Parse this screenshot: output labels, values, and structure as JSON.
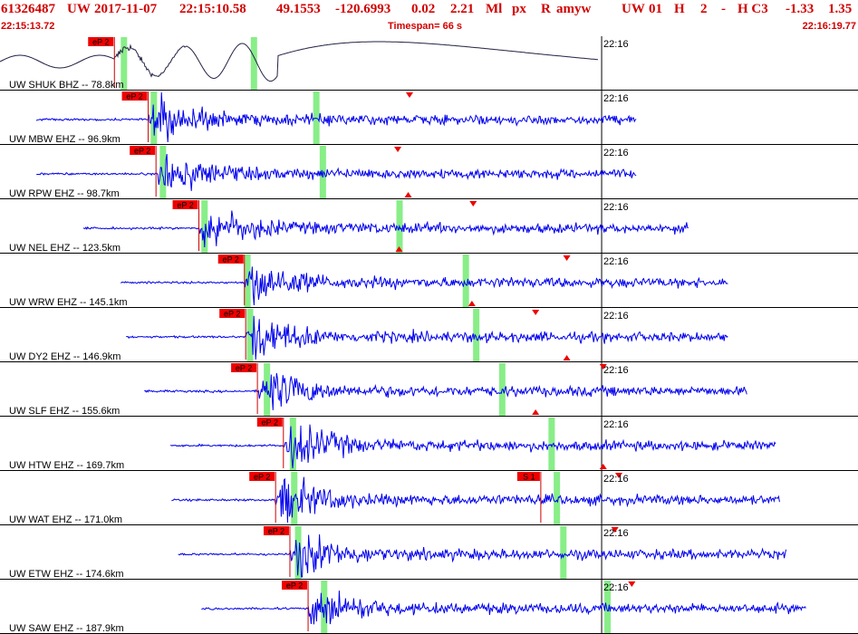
{
  "header": {
    "event_id": "61326487",
    "network": "UW",
    "origin_date": "2017-11-07",
    "origin_time": "22:15:10.58",
    "lat": "49.1553",
    "lon": "-120.6993",
    "depth": "0.02",
    "magnitude": "2.21",
    "mag_type": "Ml",
    "etype": "px",
    "review": "R",
    "author": "amyw",
    "net_code": "UW",
    "version": "01",
    "gtype": "H",
    "nph": "2",
    "flag": "-",
    "qual": "H C3",
    "v1": "-1.33",
    "v2": "1.35",
    "start_time": "22:15:13.72",
    "timespan_label": "Timespan=  66 s",
    "end_time": "22:16:19.77"
  },
  "colors": {
    "trace": "#0000ee",
    "trace_first": "#222244",
    "pick_box": "#ee0000",
    "pick_line": "#cc0000",
    "window_bar": "#88ee88",
    "header_text": "#d10000",
    "triangle": "#ee0000"
  },
  "chart_data": {
    "type": "seismogram",
    "x_range_s": [
      0,
      66
    ],
    "minute_marker_label": "22:16",
    "minute_marker_s": 46.28,
    "traces": [
      {
        "label": "UW SHUK BHZ -- 78.8km",
        "pick": "eP 2",
        "p_s": 8.8,
        "green_s": [
          9.5,
          19.5
        ],
        "trace_span_s": [
          0,
          46
        ],
        "style": "low-freq",
        "triangles": []
      },
      {
        "label": "UW MBW EHZ -- 96.9km",
        "pick": "eP 2",
        "p_s": 11.4,
        "green_s": [
          11.8,
          24.3
        ],
        "trace_span_s": [
          2.8,
          49
        ],
        "style": "normal",
        "triangles": [
          {
            "t": 31.5,
            "dir": "down"
          }
        ]
      },
      {
        "label": "UW RPW EHZ -- 98.7km",
        "pick": "eP 2",
        "p_s": 12.0,
        "green_s": [
          12.5,
          24.8
        ],
        "trace_span_s": [
          2.8,
          49
        ],
        "style": "normal",
        "triangles": [
          {
            "t": 30.6,
            "dir": "down"
          },
          {
            "t": 31.4,
            "dir": "up"
          }
        ]
      },
      {
        "label": "UW NEL EHZ -- 123.5km",
        "pick": "eP 2",
        "p_s": 15.3,
        "green_s": [
          15.7,
          30.7
        ],
        "trace_span_s": [
          6.4,
          53
        ],
        "style": "normal",
        "triangles": [
          {
            "t": 30.7,
            "dir": "up"
          },
          {
            "t": 36.4,
            "dir": "down"
          }
        ]
      },
      {
        "label": "UW WRW EHZ -- 145.1km",
        "pick": "eP 2",
        "p_s": 18.8,
        "green_s": [
          19.0,
          35.8
        ],
        "trace_span_s": [
          9.3,
          56
        ],
        "style": "normal",
        "triangles": [
          {
            "t": 36.3,
            "dir": "up"
          },
          {
            "t": 43.6,
            "dir": "down"
          }
        ]
      },
      {
        "label": "UW DY2 EHZ -- 146.9km",
        "pick": "eP 2",
        "p_s": 18.9,
        "green_s": [
          19.2,
          36.6
        ],
        "trace_span_s": [
          9.7,
          56
        ],
        "style": "normal",
        "triangles": [
          {
            "t": 43.6,
            "dir": "up"
          },
          {
            "t": 41.2,
            "dir": "down"
          }
        ]
      },
      {
        "label": "UW SLF EHZ -- 155.6km",
        "pick": "eP 2",
        "p_s": 19.8,
        "green_s": [
          20.5,
          38.6
        ],
        "trace_span_s": [
          11.1,
          57.5
        ],
        "style": "normal",
        "triangles": [
          {
            "t": 41.2,
            "dir": "up"
          },
          {
            "t": 46.4,
            "dir": "down"
          }
        ]
      },
      {
        "label": "UW HTW EHZ -- 169.7km",
        "pick": "eP 2",
        "p_s": 21.8,
        "green_s": [
          22.5,
          42.4
        ],
        "trace_span_s": [
          13.1,
          59.7
        ],
        "style": "normal",
        "triangles": [
          {
            "t": 46.4,
            "dir": "up"
          }
        ]
      },
      {
        "label": "UW WAT EHZ -- 171.0km",
        "pick": "eP 2",
        "p_s": 21.2,
        "green_s": [
          22.6,
          42.8
        ],
        "trace_span_s": [
          13.2,
          60
        ],
        "style": "normal",
        "extra_pick": {
          "label": "S 1",
          "t": 41.6
        },
        "triangles": [
          {
            "t": 47.6,
            "dir": "down"
          }
        ]
      },
      {
        "label": "UW ETW EHZ -- 174.6km",
        "pick": "eP 2",
        "p_s": 22.3,
        "green_s": [
          22.9,
          43.3
        ],
        "trace_span_s": [
          13.7,
          60.5
        ],
        "style": "normal",
        "triangles": [
          {
            "t": 47.3,
            "dir": "down"
          }
        ]
      },
      {
        "label": "UW SAW EHZ -- 187.9km",
        "pick": "eP 2",
        "p_s": 23.7,
        "green_s": [
          24.9,
          46.7
        ],
        "trace_span_s": [
          15.5,
          62
        ],
        "style": "normal",
        "triangles": [
          {
            "t": 48.6,
            "dir": "down"
          }
        ]
      }
    ]
  }
}
